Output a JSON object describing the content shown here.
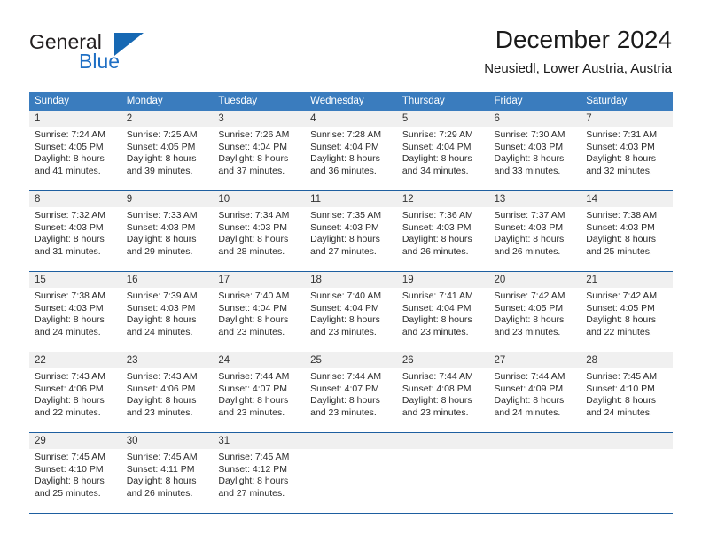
{
  "brand": {
    "name_part1": "General",
    "name_part2": "Blue",
    "flag_icon": "triangle-flag-icon"
  },
  "header": {
    "title": "December 2024",
    "subtitle": "Neusiedl, Lower Austria, Austria"
  },
  "colors": {
    "header_blue": "#3a7cbe",
    "separator_blue": "#1e5fa0",
    "daynum_band": "#f0f0f0",
    "brand_blue": "#1f6fc4"
  },
  "calendar": {
    "weekday_headers": [
      "Sunday",
      "Monday",
      "Tuesday",
      "Wednesday",
      "Thursday",
      "Friday",
      "Saturday"
    ],
    "weeks": [
      [
        {
          "day": "1",
          "sunrise": "Sunrise: 7:24 AM",
          "sunset": "Sunset: 4:05 PM",
          "daylight1": "Daylight: 8 hours",
          "daylight2": "and 41 minutes."
        },
        {
          "day": "2",
          "sunrise": "Sunrise: 7:25 AM",
          "sunset": "Sunset: 4:05 PM",
          "daylight1": "Daylight: 8 hours",
          "daylight2": "and 39 minutes."
        },
        {
          "day": "3",
          "sunrise": "Sunrise: 7:26 AM",
          "sunset": "Sunset: 4:04 PM",
          "daylight1": "Daylight: 8 hours",
          "daylight2": "and 37 minutes."
        },
        {
          "day": "4",
          "sunrise": "Sunrise: 7:28 AM",
          "sunset": "Sunset: 4:04 PM",
          "daylight1": "Daylight: 8 hours",
          "daylight2": "and 36 minutes."
        },
        {
          "day": "5",
          "sunrise": "Sunrise: 7:29 AM",
          "sunset": "Sunset: 4:04 PM",
          "daylight1": "Daylight: 8 hours",
          "daylight2": "and 34 minutes."
        },
        {
          "day": "6",
          "sunrise": "Sunrise: 7:30 AM",
          "sunset": "Sunset: 4:03 PM",
          "daylight1": "Daylight: 8 hours",
          "daylight2": "and 33 minutes."
        },
        {
          "day": "7",
          "sunrise": "Sunrise: 7:31 AM",
          "sunset": "Sunset: 4:03 PM",
          "daylight1": "Daylight: 8 hours",
          "daylight2": "and 32 minutes."
        }
      ],
      [
        {
          "day": "8",
          "sunrise": "Sunrise: 7:32 AM",
          "sunset": "Sunset: 4:03 PM",
          "daylight1": "Daylight: 8 hours",
          "daylight2": "and 31 minutes."
        },
        {
          "day": "9",
          "sunrise": "Sunrise: 7:33 AM",
          "sunset": "Sunset: 4:03 PM",
          "daylight1": "Daylight: 8 hours",
          "daylight2": "and 29 minutes."
        },
        {
          "day": "10",
          "sunrise": "Sunrise: 7:34 AM",
          "sunset": "Sunset: 4:03 PM",
          "daylight1": "Daylight: 8 hours",
          "daylight2": "and 28 minutes."
        },
        {
          "day": "11",
          "sunrise": "Sunrise: 7:35 AM",
          "sunset": "Sunset: 4:03 PM",
          "daylight1": "Daylight: 8 hours",
          "daylight2": "and 27 minutes."
        },
        {
          "day": "12",
          "sunrise": "Sunrise: 7:36 AM",
          "sunset": "Sunset: 4:03 PM",
          "daylight1": "Daylight: 8 hours",
          "daylight2": "and 26 minutes."
        },
        {
          "day": "13",
          "sunrise": "Sunrise: 7:37 AM",
          "sunset": "Sunset: 4:03 PM",
          "daylight1": "Daylight: 8 hours",
          "daylight2": "and 26 minutes."
        },
        {
          "day": "14",
          "sunrise": "Sunrise: 7:38 AM",
          "sunset": "Sunset: 4:03 PM",
          "daylight1": "Daylight: 8 hours",
          "daylight2": "and 25 minutes."
        }
      ],
      [
        {
          "day": "15",
          "sunrise": "Sunrise: 7:38 AM",
          "sunset": "Sunset: 4:03 PM",
          "daylight1": "Daylight: 8 hours",
          "daylight2": "and 24 minutes."
        },
        {
          "day": "16",
          "sunrise": "Sunrise: 7:39 AM",
          "sunset": "Sunset: 4:03 PM",
          "daylight1": "Daylight: 8 hours",
          "daylight2": "and 24 minutes."
        },
        {
          "day": "17",
          "sunrise": "Sunrise: 7:40 AM",
          "sunset": "Sunset: 4:04 PM",
          "daylight1": "Daylight: 8 hours",
          "daylight2": "and 23 minutes."
        },
        {
          "day": "18",
          "sunrise": "Sunrise: 7:40 AM",
          "sunset": "Sunset: 4:04 PM",
          "daylight1": "Daylight: 8 hours",
          "daylight2": "and 23 minutes."
        },
        {
          "day": "19",
          "sunrise": "Sunrise: 7:41 AM",
          "sunset": "Sunset: 4:04 PM",
          "daylight1": "Daylight: 8 hours",
          "daylight2": "and 23 minutes."
        },
        {
          "day": "20",
          "sunrise": "Sunrise: 7:42 AM",
          "sunset": "Sunset: 4:05 PM",
          "daylight1": "Daylight: 8 hours",
          "daylight2": "and 23 minutes."
        },
        {
          "day": "21",
          "sunrise": "Sunrise: 7:42 AM",
          "sunset": "Sunset: 4:05 PM",
          "daylight1": "Daylight: 8 hours",
          "daylight2": "and 22 minutes."
        }
      ],
      [
        {
          "day": "22",
          "sunrise": "Sunrise: 7:43 AM",
          "sunset": "Sunset: 4:06 PM",
          "daylight1": "Daylight: 8 hours",
          "daylight2": "and 22 minutes."
        },
        {
          "day": "23",
          "sunrise": "Sunrise: 7:43 AM",
          "sunset": "Sunset: 4:06 PM",
          "daylight1": "Daylight: 8 hours",
          "daylight2": "and 23 minutes."
        },
        {
          "day": "24",
          "sunrise": "Sunrise: 7:44 AM",
          "sunset": "Sunset: 4:07 PM",
          "daylight1": "Daylight: 8 hours",
          "daylight2": "and 23 minutes."
        },
        {
          "day": "25",
          "sunrise": "Sunrise: 7:44 AM",
          "sunset": "Sunset: 4:07 PM",
          "daylight1": "Daylight: 8 hours",
          "daylight2": "and 23 minutes."
        },
        {
          "day": "26",
          "sunrise": "Sunrise: 7:44 AM",
          "sunset": "Sunset: 4:08 PM",
          "daylight1": "Daylight: 8 hours",
          "daylight2": "and 23 minutes."
        },
        {
          "day": "27",
          "sunrise": "Sunrise: 7:44 AM",
          "sunset": "Sunset: 4:09 PM",
          "daylight1": "Daylight: 8 hours",
          "daylight2": "and 24 minutes."
        },
        {
          "day": "28",
          "sunrise": "Sunrise: 7:45 AM",
          "sunset": "Sunset: 4:10 PM",
          "daylight1": "Daylight: 8 hours",
          "daylight2": "and 24 minutes."
        }
      ],
      [
        {
          "day": "29",
          "sunrise": "Sunrise: 7:45 AM",
          "sunset": "Sunset: 4:10 PM",
          "daylight1": "Daylight: 8 hours",
          "daylight2": "and 25 minutes."
        },
        {
          "day": "30",
          "sunrise": "Sunrise: 7:45 AM",
          "sunset": "Sunset: 4:11 PM",
          "daylight1": "Daylight: 8 hours",
          "daylight2": "and 26 minutes."
        },
        {
          "day": "31",
          "sunrise": "Sunrise: 7:45 AM",
          "sunset": "Sunset: 4:12 PM",
          "daylight1": "Daylight: 8 hours",
          "daylight2": "and 27 minutes."
        },
        {
          "day": "",
          "sunrise": "",
          "sunset": "",
          "daylight1": "",
          "daylight2": ""
        },
        {
          "day": "",
          "sunrise": "",
          "sunset": "",
          "daylight1": "",
          "daylight2": ""
        },
        {
          "day": "",
          "sunrise": "",
          "sunset": "",
          "daylight1": "",
          "daylight2": ""
        },
        {
          "day": "",
          "sunrise": "",
          "sunset": "",
          "daylight1": "",
          "daylight2": ""
        }
      ]
    ]
  }
}
